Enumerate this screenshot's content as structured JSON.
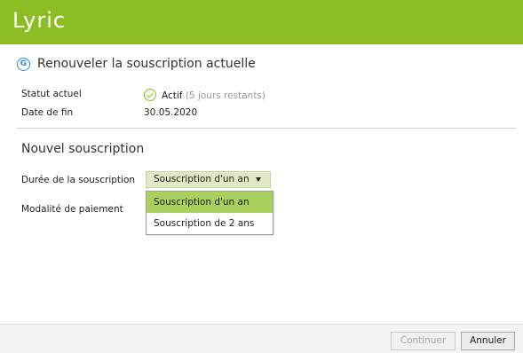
{
  "app": {
    "logo": "Lyric",
    "brand_color": "#8cbe24"
  },
  "section": {
    "title": "Renouveler la souscription actuelle",
    "icon": "g-circle-icon"
  },
  "status": {
    "label": "Statut actuel",
    "value": "Actif",
    "remaining": "(5 jours restants)",
    "icon": "check-circle-icon"
  },
  "end_date": {
    "label": "Date de fin",
    "value": "30.05.2020"
  },
  "new_subscription": {
    "title": "Nouvel souscription",
    "duration_label": "Durée de la souscription",
    "duration_selected": "Souscription d'un an",
    "payment_label": "Modalité de paiement",
    "options": [
      "Souscription d'un an",
      "Souscription de 2 ans"
    ]
  },
  "buttons": {
    "continue": "Continuer",
    "cancel": "Annuler"
  }
}
